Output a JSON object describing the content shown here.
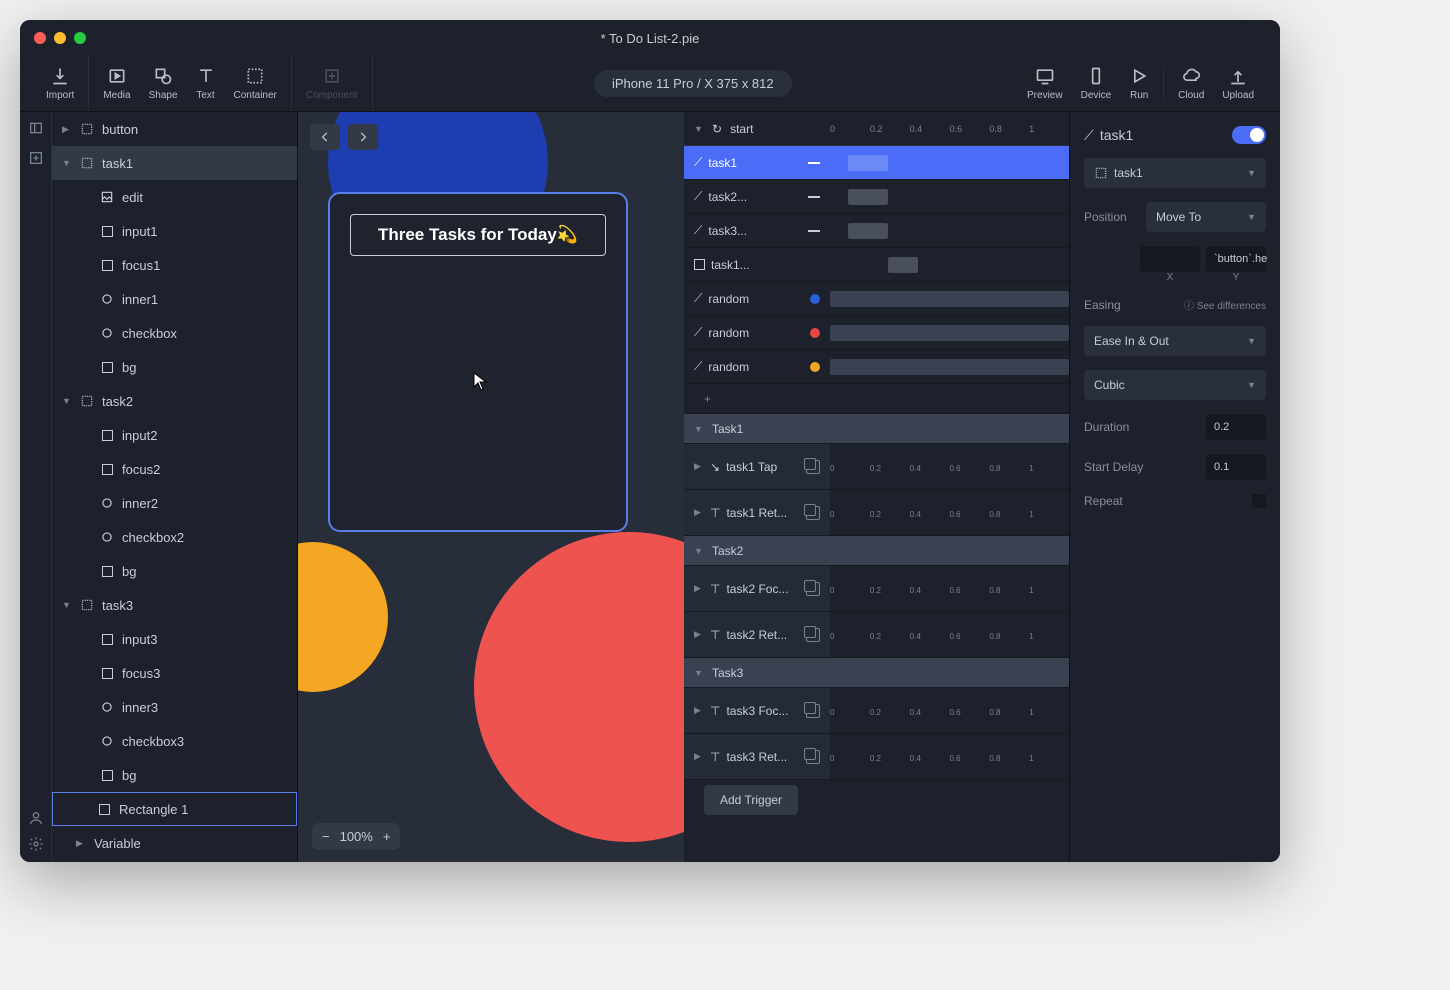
{
  "window": {
    "title": "* To Do List-2.pie"
  },
  "toolbar": {
    "import": "Import",
    "media": "Media",
    "shape": "Shape",
    "text": "Text",
    "container": "Container",
    "component": "Component",
    "device": "iPhone 11 Pro / X  375 x 812",
    "preview": "Preview",
    "device_btn": "Device",
    "run": "Run",
    "cloud": "Cloud",
    "upload": "Upload"
  },
  "layers": {
    "button": "button",
    "task1": {
      "name": "task1",
      "children": {
        "edit": "edit",
        "input1": "input1",
        "focus1": "focus1",
        "inner1": "inner1",
        "checkbox": "checkbox",
        "bg": "bg"
      }
    },
    "task2": {
      "name": "task2",
      "children": {
        "input2": "input2",
        "focus2": "focus2",
        "inner2": "inner2",
        "checkbox2": "checkbox2",
        "bg": "bg"
      }
    },
    "task3": {
      "name": "task3",
      "children": {
        "input3": "input3",
        "focus3": "focus3",
        "inner3": "inner3",
        "checkbox3": "checkbox3",
        "bg": "bg"
      }
    },
    "rectangle": "Rectangle 1",
    "variable": "Variable"
  },
  "canvas": {
    "title": "Three Tasks for Today💫",
    "zoom": "100%"
  },
  "timeline": {
    "start": "start",
    "ruler": [
      "0",
      "0.2",
      "0.4",
      "0.6",
      "0.8",
      "1"
    ],
    "tracks": [
      {
        "name": "task1",
        "active": true
      },
      {
        "name": "task2..."
      },
      {
        "name": "task3..."
      },
      {
        "name": "task1..."
      },
      {
        "name": "random",
        "color": "#2a5fd8"
      },
      {
        "name": "random",
        "color": "#e64545"
      },
      {
        "name": "random",
        "color": "#f5a623"
      }
    ],
    "groups": [
      {
        "name": "Task1",
        "triggers": [
          "task1 Tap",
          "task1 Ret..."
        ]
      },
      {
        "name": "Task2",
        "triggers": [
          "task2 Foc...",
          "task2 Ret..."
        ]
      },
      {
        "name": "Task3",
        "triggers": [
          "task3 Foc...",
          "task3 Ret..."
        ]
      }
    ],
    "add": "Add Trigger"
  },
  "props": {
    "title": "task1",
    "selector": "task1",
    "position_label": "Position",
    "position_mode": "Move To",
    "y_val": "`button`.he",
    "x_label": "X",
    "y_label": "Y",
    "easing_label": "Easing",
    "see_diff": "See differences",
    "ease_type": "Ease In & Out",
    "ease_curve": "Cubic",
    "duration_label": "Duration",
    "duration_val": "0.2",
    "delay_label": "Start Delay",
    "delay_val": "0.1",
    "repeat_label": "Repeat"
  }
}
